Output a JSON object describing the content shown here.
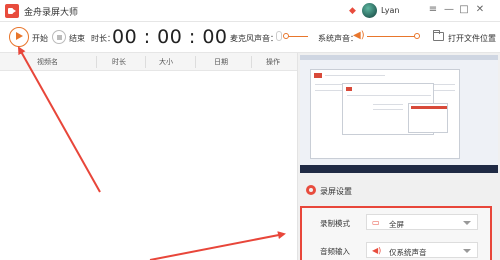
{
  "app": {
    "title": "金舟录屏大师",
    "user_name": "Lyan"
  },
  "toolbar": {
    "start_label": "开始",
    "stop_label": "结束",
    "duration_label": "时长：",
    "timer": "00 : 00 : 00",
    "mic_label": "麦克风声音：",
    "mic_level": 0,
    "system_audio_label": "系统声音：",
    "system_audio_level": 1,
    "open_folder_label": "打开文件位置"
  },
  "table": {
    "columns": [
      "视频名",
      "时长",
      "大小",
      "日期",
      "操作"
    ],
    "rows": []
  },
  "settings": {
    "title": "录屏设置",
    "items": [
      {
        "label": "录制模式",
        "value": "全屏",
        "icon": "monitor-icon"
      },
      {
        "label": "音频输入",
        "value": "仅系统声音",
        "icon": "speaker-icon"
      }
    ]
  },
  "colors": {
    "accent": "#e8762c",
    "brand_red": "#e84c3d",
    "annotation_red": "#e8463a"
  },
  "icons": {
    "app_logo": "camera-icon",
    "vip": "diamond-icon",
    "minimize": "minimize-icon",
    "maximize": "maximize-icon",
    "close": "close-icon"
  }
}
